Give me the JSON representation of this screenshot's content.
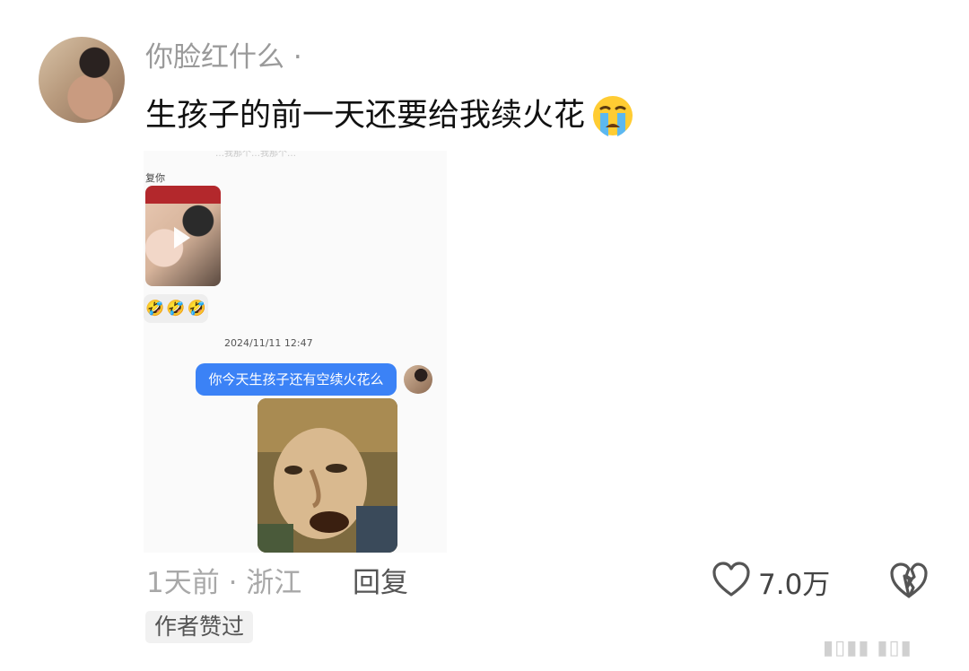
{
  "comment": {
    "username": "你脸红什么 ·",
    "text": "生孩子的前一天还要给我续火花",
    "emoji_icon": "loudly-crying-face-icon"
  },
  "screenshot": {
    "cutoff_text": "…我那个…我那个…",
    "reply_label": "复你",
    "video_icon": "play-icon",
    "emoji_row": [
      "🤣",
      "🤣",
      "🤣"
    ],
    "timestamp": "2024/11/11 12:47",
    "message": "你今天生孩子还有空续火花么"
  },
  "footer": {
    "meta": "1天前 · 浙江",
    "reply_label": "回复",
    "like_count": "7.0万",
    "like_icon": "heart-outline-icon",
    "dislike_icon": "broken-heart-icon",
    "author_badge": "作者赞过"
  },
  "watermark": "▮▯▮▮ ▮▯▮"
}
